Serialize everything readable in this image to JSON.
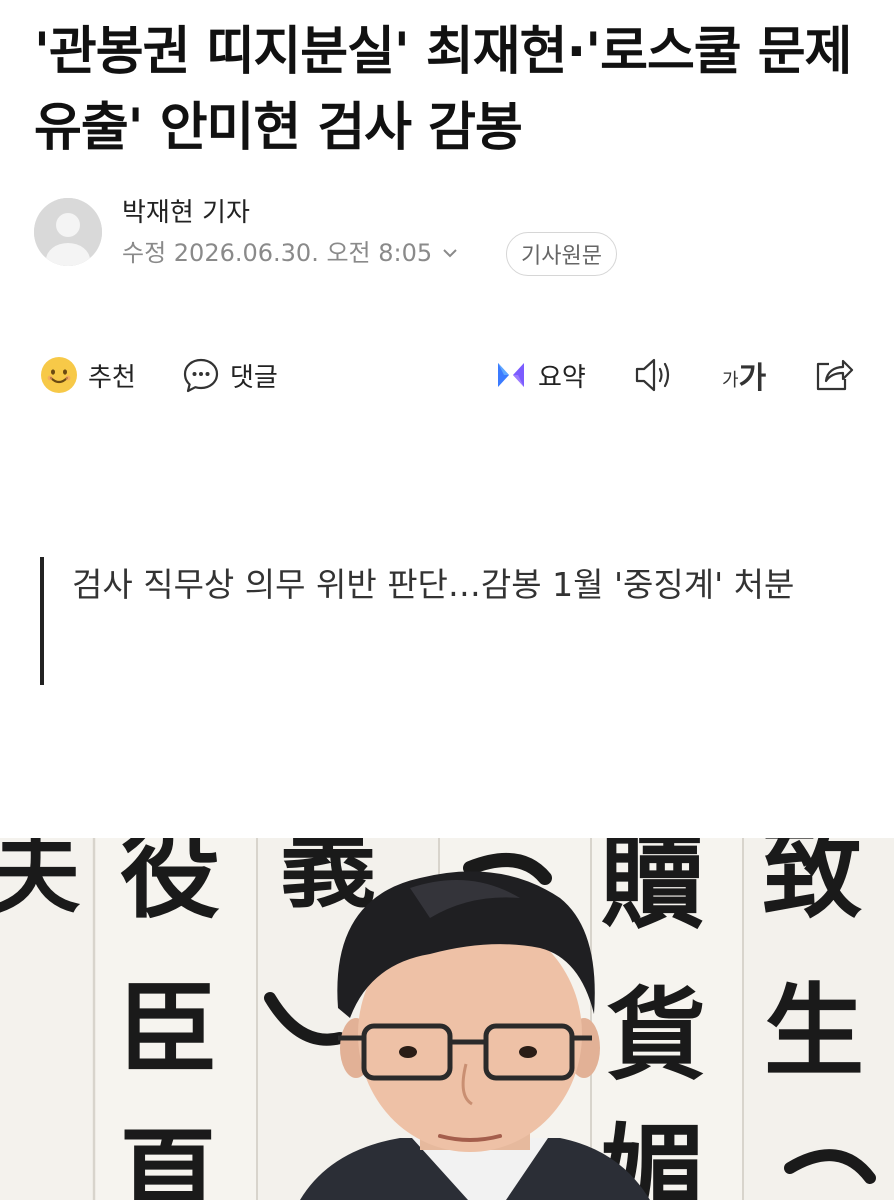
{
  "article": {
    "headline": "'관봉권 띠지분실' 최재현·'로스쿨 문제유출' 안미현 검사 감봉",
    "author": "박재현 기자",
    "modified": "수정 2026.06.30. 오전 8:05",
    "origin_button": "기사원문",
    "subtitle": "검사 직무상 의무 위반 판단…감봉 1월 '중징계' 처분"
  },
  "actions": {
    "recommend": "추천",
    "comment": "댓글",
    "summary": "요약",
    "font_small": "가",
    "font_large": "가"
  },
  "photo": {
    "calligraphy": [
      "夫",
      "役",
      "義",
      "贖",
      "致",
      "臣",
      "貨",
      "生",
      "頁",
      "媚"
    ]
  },
  "colors": {
    "accent_summary": "#3b7bff",
    "emoji_yellow": "#f7c948",
    "subtitle_bar": "#222222"
  }
}
